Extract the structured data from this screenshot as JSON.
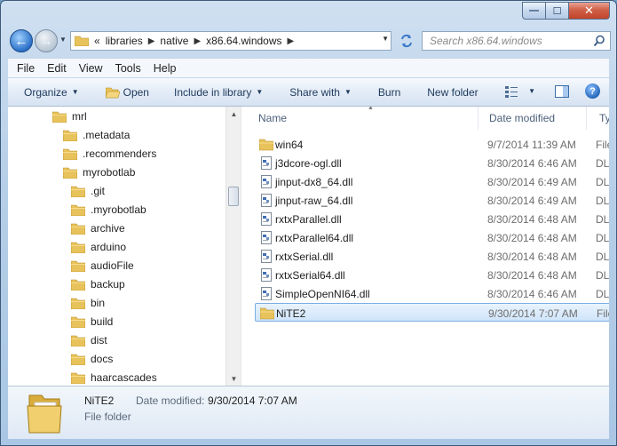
{
  "colors": {
    "accent": "#3a78c8",
    "selection_bg": "#cfe5fb",
    "selection_border": "#7daee3",
    "folder": "#e8c25b"
  },
  "window": {
    "minimize": "—",
    "maximize": "☐",
    "close": "✕"
  },
  "nav": {
    "back": "←",
    "forward": "→",
    "breadcrumb": [
      "libraries",
      "native",
      "x86.64.windows"
    ],
    "search_placeholder": "Search x86.64.windows"
  },
  "menu": [
    "File",
    "Edit",
    "View",
    "Tools",
    "Help"
  ],
  "toolbar": {
    "organize": "Organize",
    "open": "Open",
    "include_in_library": "Include in library",
    "share_with": "Share with",
    "burn": "Burn",
    "new_folder": "New folder",
    "help": "?"
  },
  "tree": [
    {
      "label": "mrl",
      "level": 0
    },
    {
      "label": ".metadata",
      "level": 1
    },
    {
      "label": ".recommenders",
      "level": 1
    },
    {
      "label": "myrobotlab",
      "level": 1
    },
    {
      "label": ".git",
      "level": 2
    },
    {
      "label": ".myrobotlab",
      "level": 2
    },
    {
      "label": "archive",
      "level": 2
    },
    {
      "label": "arduino",
      "level": 2
    },
    {
      "label": "audioFile",
      "level": 2
    },
    {
      "label": "backup",
      "level": 2
    },
    {
      "label": "bin",
      "level": 2
    },
    {
      "label": "build",
      "level": 2
    },
    {
      "label": "dist",
      "level": 2
    },
    {
      "label": "docs",
      "level": 2
    },
    {
      "label": "haarcascades",
      "level": 2
    }
  ],
  "columns": {
    "name": "Name",
    "date": "Date modified",
    "type": "Typ"
  },
  "files": [
    {
      "name": "win64",
      "date": "9/7/2014 11:39 AM",
      "type": "File",
      "kind": "folder",
      "selected": false
    },
    {
      "name": "j3dcore-ogl.dll",
      "date": "8/30/2014 6:46 AM",
      "type": "DLL",
      "kind": "dll",
      "selected": false
    },
    {
      "name": "jinput-dx8_64.dll",
      "date": "8/30/2014 6:49 AM",
      "type": "DLL",
      "kind": "dll",
      "selected": false
    },
    {
      "name": "jinput-raw_64.dll",
      "date": "8/30/2014 6:49 AM",
      "type": "DLL",
      "kind": "dll",
      "selected": false
    },
    {
      "name": "rxtxParallel.dll",
      "date": "8/30/2014 6:48 AM",
      "type": "DLL",
      "kind": "dll",
      "selected": false
    },
    {
      "name": "rxtxParallel64.dll",
      "date": "8/30/2014 6:48 AM",
      "type": "DLL",
      "kind": "dll",
      "selected": false
    },
    {
      "name": "rxtxSerial.dll",
      "date": "8/30/2014 6:48 AM",
      "type": "DLL",
      "kind": "dll",
      "selected": false
    },
    {
      "name": "rxtxSerial64.dll",
      "date": "8/30/2014 6:48 AM",
      "type": "DLL",
      "kind": "dll",
      "selected": false
    },
    {
      "name": "SimpleOpenNI64.dll",
      "date": "8/30/2014 6:46 AM",
      "type": "DLL",
      "kind": "dll",
      "selected": false
    },
    {
      "name": "NiTE2",
      "date": "9/30/2014 7:07 AM",
      "type": "File",
      "kind": "folder",
      "selected": true
    }
  ],
  "details": {
    "name": "NiTE2",
    "date_label": "Date modified:",
    "date": "9/30/2014 7:07 AM",
    "type": "File folder"
  }
}
